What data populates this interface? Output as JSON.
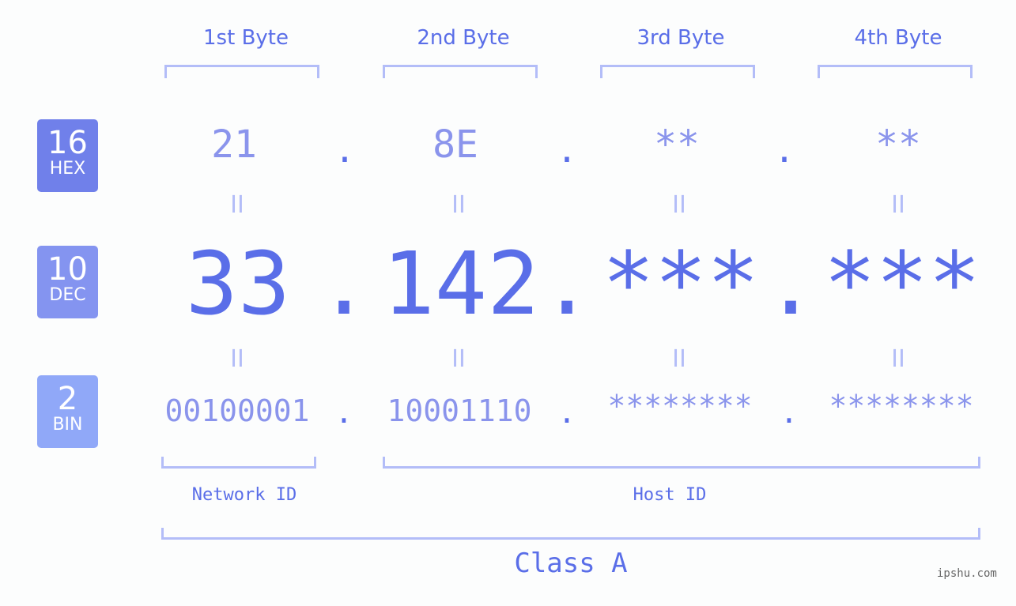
{
  "headers": [
    "1st Byte",
    "2nd Byte",
    "3rd Byte",
    "4th Byte"
  ],
  "badges": {
    "hex": {
      "num": "16",
      "label": "HEX",
      "color": "#7080ea"
    },
    "dec": {
      "num": "10",
      "label": "DEC",
      "color": "#8494f0"
    },
    "bin": {
      "num": "2",
      "label": "BIN",
      "color": "#90a8f8"
    }
  },
  "hex": [
    "21",
    "8E",
    "**",
    "**"
  ],
  "dec": [
    "33",
    "142",
    "***",
    "***"
  ],
  "bin": [
    "00100001",
    "10001110",
    "********",
    "********"
  ],
  "separator": ".",
  "equals": "II",
  "network_label": "Network ID",
  "host_label": "Host ID",
  "class_label": "Class A",
  "watermark": "ipshu.com"
}
